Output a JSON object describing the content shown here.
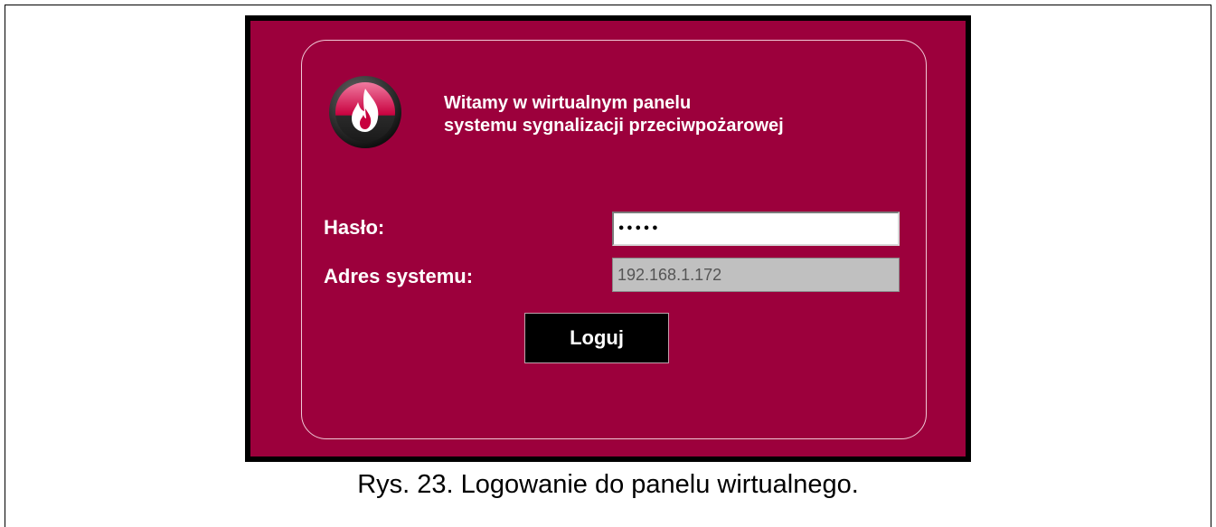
{
  "panel": {
    "welcome_line1": "Witamy w wirtualnym panelu",
    "welcome_line2": "systemu sygnalizacji przeciwpożarowej",
    "password_label": "Hasło:",
    "password_value": "•••••",
    "address_label": "Adres systemu:",
    "address_value": "192.168.1.172",
    "login_button": "Loguj",
    "logo_icon": "flame-logo-icon"
  },
  "caption": "Rys. 23. Logowanie do panelu wirtualnego.",
  "colors": {
    "panel_background": "#9c003c",
    "button_background": "#000000",
    "disabled_field": "#c0c0c0"
  }
}
